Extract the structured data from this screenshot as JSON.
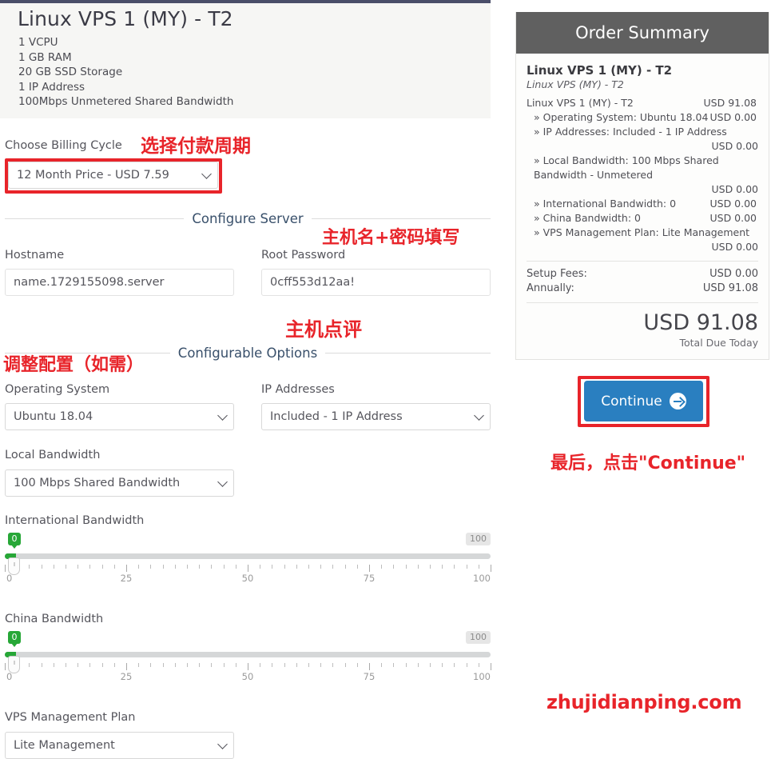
{
  "plan": {
    "title": "Linux VPS 1 (MY) - T2",
    "features": [
      "1 VCPU",
      "1 GB RAM",
      "20 GB SSD Storage",
      "1 IP Address",
      "100Mbps Unmetered Shared Bandwidth"
    ]
  },
  "billing": {
    "label": "Choose Billing Cycle",
    "selected": "12 Month Price - USD 7.59"
  },
  "sections": {
    "configure_server": "Configure Server",
    "configurable_options": "Configurable Options"
  },
  "server": {
    "hostname_label": "Hostname",
    "hostname_value": "name.1729155098.server",
    "password_label": "Root Password",
    "password_value": "0cff553d12aa!"
  },
  "options": {
    "os_label": "Operating System",
    "os_value": "Ubuntu 18.04",
    "ip_label": "IP Addresses",
    "ip_value": "Included - 1 IP Address",
    "local_bw_label": "Local Bandwidth",
    "local_bw_value": "100 Mbps Shared Bandwidth",
    "mgmt_label": "VPS Management Plan",
    "mgmt_value": "Lite Management"
  },
  "sliders": [
    {
      "label": "International Bandwidth",
      "value": "0",
      "max_badge": "100",
      "ticks": [
        "0",
        "25",
        "50",
        "75",
        "100"
      ],
      "min": 0,
      "max": 100
    },
    {
      "label": "China Bandwidth",
      "value": "0",
      "max_badge": "100",
      "ticks": [
        "0",
        "25",
        "50",
        "75",
        "100"
      ],
      "min": 0,
      "max": 100
    }
  ],
  "order_summary": {
    "header": "Order Summary",
    "product_name": "Linux VPS 1 (MY) - T2",
    "product_sub": "Linux VPS (MY) - T2",
    "base_line_label": "Linux VPS 1 (MY) - T2",
    "base_line_amount": "USD 91.08",
    "items": [
      {
        "text": "» Operating System: Ubuntu 18.04",
        "amount": "USD 0.00",
        "wrap": false
      },
      {
        "text": "» IP Addresses: Included - 1 IP Address",
        "amount": "USD 0.00",
        "wrap": true
      },
      {
        "text": "» Local Bandwidth: 100 Mbps Shared Bandwidth - Unmetered",
        "amount": "USD 0.00",
        "wrap": true
      },
      {
        "text": "» International Bandwidth: 0",
        "amount": "USD 0.00",
        "wrap": false
      },
      {
        "text": "» China Bandwidth: 0",
        "amount": "USD 0.00",
        "wrap": false
      },
      {
        "text": "» VPS Management Plan: Lite Management",
        "amount": "USD 0.00",
        "wrap": true
      }
    ],
    "setup_fees_label": "Setup Fees:",
    "setup_fees_value": "USD 0.00",
    "annually_label": "Annually:",
    "annually_value": "USD 91.08",
    "grand_total": "USD 91.08",
    "total_due_today": "Total Due Today"
  },
  "continue_button": {
    "label": "Continue"
  },
  "annotations": {
    "billing": "选择付款周期",
    "hostname_password": "主机名+密码填写",
    "review": "主机点评",
    "adjust_config": "调整配置（如需）",
    "click_continue": "最后，点击\"Continue\"",
    "watermark": "zhujidianping.com"
  },
  "colors": {
    "accent_red": "#e8242a",
    "button_blue": "#2a7fc0",
    "summary_header_gray": "#606060",
    "slider_green": "#27a737",
    "section_heading_blue": "#39506b",
    "top_bar_navy": "#4a4e69"
  }
}
